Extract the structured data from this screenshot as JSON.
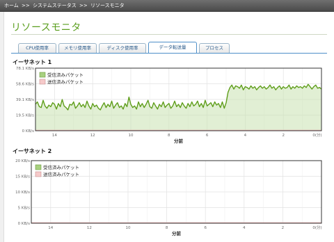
{
  "breadcrumb": {
    "home": "ホーム",
    "status": "システムステータス",
    "current": "リソースモニタ",
    "separator": ">>"
  },
  "page": {
    "title": "リソースモニタ"
  },
  "tabs": [
    {
      "label": "CPU使用率",
      "active": false
    },
    {
      "label": "メモリ使用率",
      "active": false
    },
    {
      "label": "ディスク使用率",
      "active": false
    },
    {
      "label": "データ転送量",
      "active": true
    },
    {
      "label": "プロセス",
      "active": false
    }
  ],
  "colors": {
    "received": "#5f9e1b",
    "received_legend": "#a8d080",
    "sent": "#e8b0b0",
    "title": "#5a9e1e",
    "tab_accent": "#4d8fc8"
  },
  "chart_data": [
    {
      "type": "area",
      "title": "イーサネット 1",
      "xlabel": "分前",
      "ylabel": "",
      "y_ticks": [
        "0 KB/s",
        "19.5 KB/s",
        "39.1 KB/s",
        "58.6 KB/s",
        "78.1 KB/s"
      ],
      "ylim": [
        0,
        78.1
      ],
      "x_ticks": [
        "14",
        "12",
        "10",
        "8",
        "6",
        "4",
        "2",
        "0(分)"
      ],
      "xlim": [
        15,
        0
      ],
      "grid": true,
      "legend_position": "top-left",
      "series": [
        {
          "name": "受信済みパケット",
          "x": [
            15.0,
            14.9,
            14.8,
            14.7,
            14.6,
            14.5,
            14.4,
            14.3,
            14.2,
            14.1,
            14.0,
            13.9,
            13.8,
            13.7,
            13.6,
            13.5,
            13.4,
            13.3,
            13.2,
            13.1,
            13.0,
            12.9,
            12.8,
            12.7,
            12.6,
            12.5,
            12.4,
            12.3,
            12.2,
            12.1,
            12.0,
            11.9,
            11.8,
            11.7,
            11.6,
            11.5,
            11.4,
            11.3,
            11.2,
            11.1,
            11.0,
            10.9,
            10.8,
            10.7,
            10.6,
            10.5,
            10.4,
            10.3,
            10.2,
            10.1,
            10.0,
            9.9,
            9.8,
            9.7,
            9.6,
            9.5,
            9.4,
            9.3,
            9.2,
            9.1,
            9.0,
            8.9,
            8.8,
            8.7,
            8.6,
            8.5,
            8.4,
            8.3,
            8.2,
            8.1,
            8.0,
            7.9,
            7.8,
            7.7,
            7.6,
            7.5,
            7.4,
            7.3,
            7.2,
            7.1,
            7.0,
            6.9,
            6.8,
            6.7,
            6.6,
            6.5,
            6.4,
            6.3,
            6.2,
            6.1,
            6.0,
            5.9,
            5.8,
            5.7,
            5.6,
            5.5,
            5.4,
            5.3,
            5.2,
            5.1,
            5.0,
            4.9,
            4.8,
            4.7,
            4.6,
            4.5,
            4.4,
            4.3,
            4.2,
            4.1,
            4.0,
            3.9,
            3.8,
            3.7,
            3.6,
            3.5,
            3.4,
            3.3,
            3.2,
            3.1,
            3.0,
            2.9,
            2.8,
            2.7,
            2.6,
            2.5,
            2.4,
            2.3,
            2.2,
            2.1,
            2.0,
            1.9,
            1.8,
            1.7,
            1.6,
            1.5,
            1.4,
            1.3,
            1.2,
            1.1,
            1.0,
            0.9,
            0.8,
            0.7,
            0.6,
            0.5,
            0.4,
            0.3,
            0.2,
            0.1,
            0.0
          ],
          "values": [
            33,
            36,
            30,
            29,
            38,
            31,
            28,
            32,
            30,
            35,
            33,
            27,
            34,
            30,
            39,
            31,
            29,
            26,
            33,
            32,
            36,
            28,
            31,
            35,
            30,
            33,
            29,
            37,
            31,
            27,
            34,
            30,
            32,
            28,
            26,
            31,
            35,
            29,
            33,
            30,
            37,
            28,
            32,
            35,
            29,
            31,
            27,
            34,
            30,
            42,
            33,
            29,
            31,
            27,
            36,
            30,
            34,
            29,
            33,
            38,
            30,
            28,
            35,
            31,
            27,
            33,
            30,
            36,
            29,
            32,
            34,
            28,
            31,
            37,
            30,
            33,
            29,
            35,
            31,
            28,
            34,
            30,
            36,
            31,
            33,
            37,
            30,
            34,
            29,
            38,
            31,
            33,
            35,
            30,
            36,
            32,
            34,
            29,
            36,
            28,
            35,
            48,
            54,
            57,
            52,
            56,
            55,
            53,
            57,
            51,
            55,
            54,
            52,
            56,
            53,
            55,
            51,
            54,
            56,
            53,
            55,
            52,
            54,
            57,
            53,
            55,
            51,
            54,
            56,
            52,
            55,
            53,
            54,
            57,
            52,
            55,
            53,
            56,
            54,
            55,
            53,
            56,
            54,
            58,
            55,
            52,
            55,
            57,
            53,
            54,
            52
          ]
        },
        {
          "name": "送信済みパケット",
          "x": [
            15.0,
            0.0
          ],
          "values": [
            0.2,
            0.2
          ]
        }
      ]
    },
    {
      "type": "area",
      "title": "イーサネット 2",
      "xlabel": "分前",
      "ylabel": "",
      "y_ticks": [
        "0 KB/s",
        "5 KB/s",
        "10 KB/s",
        "15 KB/s",
        "20 KB/s"
      ],
      "ylim": [
        0,
        20
      ],
      "x_ticks": [
        "14",
        "12",
        "10",
        "8",
        "6",
        "4",
        "2",
        "0(分)"
      ],
      "xlim": [
        15,
        0
      ],
      "grid": true,
      "legend_position": "top-left",
      "series": [
        {
          "name": "受信済みパケット",
          "x": [
            15.0,
            0.0
          ],
          "values": [
            0.05,
            0.05
          ]
        },
        {
          "name": "送信済みパケット",
          "x": [
            15.0,
            0.0
          ],
          "values": [
            0.1,
            0.1
          ]
        }
      ]
    }
  ]
}
